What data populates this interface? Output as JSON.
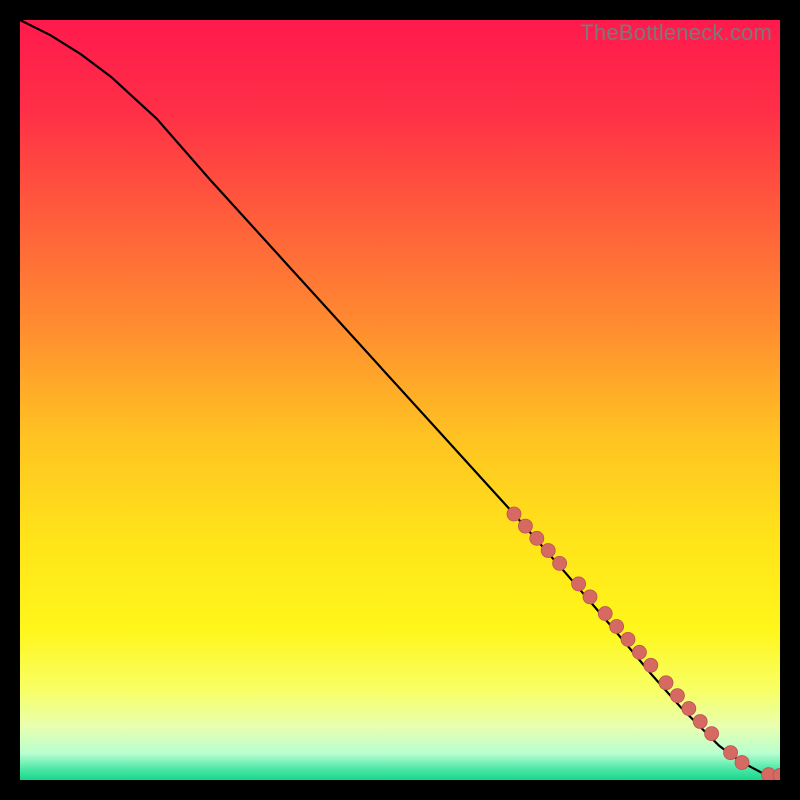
{
  "watermark": "TheBottleneck.com",
  "colors": {
    "bg_black": "#000000",
    "curve": "#000000",
    "marker_fill": "#d66a63",
    "marker_stroke": "#b85350",
    "gradient_stops": [
      {
        "offset": 0.0,
        "color": "#ff1a4d"
      },
      {
        "offset": 0.12,
        "color": "#ff2f47"
      },
      {
        "offset": 0.25,
        "color": "#ff5a3c"
      },
      {
        "offset": 0.4,
        "color": "#ff8b30"
      },
      {
        "offset": 0.55,
        "color": "#ffc322"
      },
      {
        "offset": 0.68,
        "color": "#ffe31a"
      },
      {
        "offset": 0.8,
        "color": "#fff61a"
      },
      {
        "offset": 0.88,
        "color": "#f8ff63"
      },
      {
        "offset": 0.93,
        "color": "#e8ffb0"
      },
      {
        "offset": 0.965,
        "color": "#b8ffd0"
      },
      {
        "offset": 0.985,
        "color": "#4fe8a8"
      },
      {
        "offset": 1.0,
        "color": "#18d68c"
      }
    ]
  },
  "chart_data": {
    "type": "line",
    "title": "",
    "xlabel": "",
    "ylabel": "",
    "xlim": [
      0,
      100
    ],
    "ylim": [
      0,
      100
    ],
    "series": [
      {
        "name": "bottleneck-curve",
        "x": [
          0,
          4,
          8,
          12,
          18,
          25,
          35,
          45,
          55,
          65,
          72,
          78,
          83,
          87,
          90,
          92,
          94,
          96,
          97.5,
          99,
          100
        ],
        "y": [
          100,
          98,
          95.5,
          92.5,
          87,
          79,
          68,
          57,
          46,
          35,
          27,
          20,
          14,
          9.5,
          6.5,
          4.5,
          3,
          1.8,
          1.0,
          0.6,
          0.6
        ]
      }
    ],
    "markers": {
      "name": "highlighted-points",
      "x": [
        65,
        66.5,
        68,
        69.5,
        71,
        73.5,
        75,
        77,
        78.5,
        80,
        81.5,
        83,
        85,
        86.5,
        88,
        89.5,
        91,
        93.5,
        95,
        98.5,
        100
      ],
      "y": [
        35,
        33.4,
        31.8,
        30.2,
        28.5,
        25.8,
        24.1,
        21.9,
        20.2,
        18.5,
        16.8,
        15.1,
        12.8,
        11.1,
        9.4,
        7.7,
        6.1,
        3.6,
        2.3,
        0.7,
        0.6
      ]
    }
  }
}
